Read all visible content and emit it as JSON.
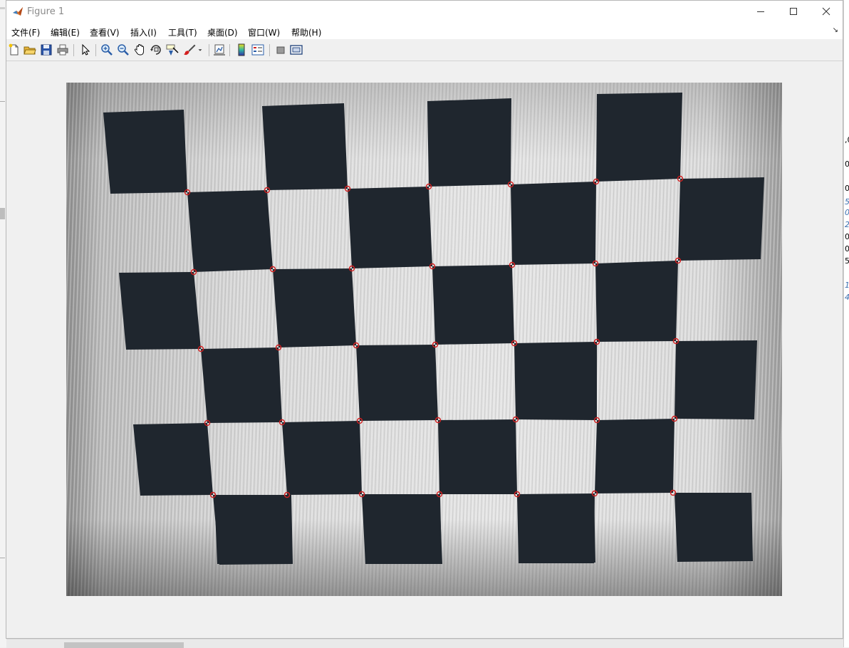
{
  "window": {
    "title": "Figure 1"
  },
  "menu": [
    "文件(F)",
    "编辑(E)",
    "查看(V)",
    "插入(I)",
    "工具(T)",
    "桌面(D)",
    "窗口(W)",
    "帮助(H)"
  ],
  "toolbar": {
    "icons": [
      "new-figure-icon",
      "open-file-icon",
      "save-icon",
      "print-icon",
      "edit-plot-icon",
      "zoom-in-icon",
      "zoom-out-icon",
      "pan-icon",
      "rotate-3d-icon",
      "data-cursor-icon",
      "brush-icon",
      "brush-dropdown-icon",
      "link-plot-icon",
      "colorbar-icon",
      "legend-icon",
      "hide-plot-tools-icon",
      "show-plot-tools-icon"
    ]
  },
  "background_app_right_fragments": [
    ",0",
    "0",
    "0",
    "5",
    "0",
    "2",
    "0",
    "0.",
    "51",
    "1",
    "4"
  ],
  "image": {
    "subject": "checkerboard calibration photo with detected corners",
    "marker_color": "#d42020"
  }
}
